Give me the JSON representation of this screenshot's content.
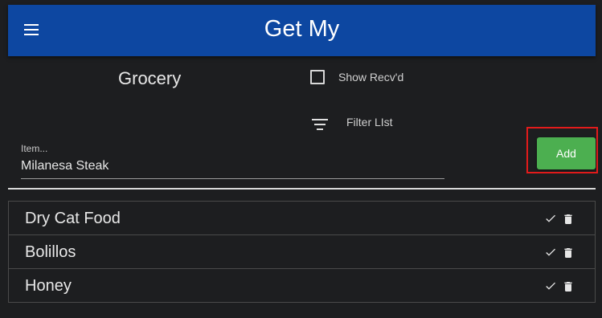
{
  "app": {
    "title": "Get My"
  },
  "icons": {
    "menu": "menu-icon",
    "filter": "filter-list-icon",
    "check": "check-icon",
    "delete": "trash-icon"
  },
  "colors": {
    "app_bar": "#0d47a1",
    "add_button": "#4caf50",
    "highlight": "#e31b1b",
    "background": "#1d1e20"
  },
  "list_name": "Grocery",
  "show_received": {
    "label": "Show Recv'd",
    "checked": false
  },
  "filter": {
    "label": "Filter LIst"
  },
  "item_input": {
    "label": "Item...",
    "value": "Milanesa Steak"
  },
  "add_button": {
    "label": "Add"
  },
  "items": [
    {
      "name": "Dry Cat Food"
    },
    {
      "name": "Bolillos"
    },
    {
      "name": "Honey"
    }
  ]
}
